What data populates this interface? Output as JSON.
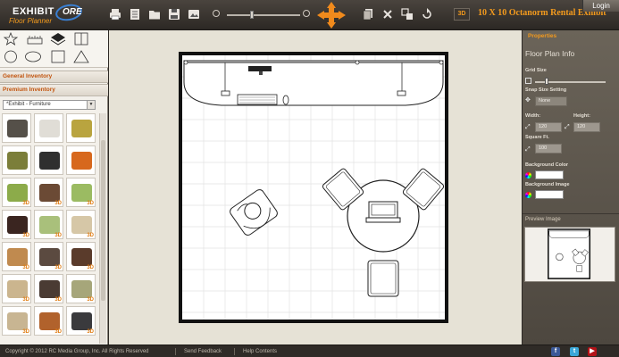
{
  "app": {
    "logo_word": "EXHIBIT",
    "logo_ore": "ORE",
    "logo_sub": "Floor Planner",
    "title": "10 X 10 Octanorm Rental Exhibit",
    "login_label": "Login",
    "view3d_label": "3D"
  },
  "toolbar": {
    "icons": [
      "print-icon",
      "document-icon",
      "folder-open-icon",
      "save-icon",
      "image-export-icon",
      "zoom-out-icon",
      "zoom-in-icon",
      "move-arrows-icon",
      "copy-icon",
      "delete-icon",
      "group-icon",
      "rotate-icon"
    ]
  },
  "left_panel": {
    "shape_tools": [
      "star-icon",
      "ruler-icon",
      "layers-icon",
      "floorplan-view-icon",
      "circle-icon",
      "ellipse-icon",
      "square-icon",
      "triangle-icon"
    ],
    "general_inventory_label": "General Inventory",
    "premium_inventory_label": "Premium Inventory",
    "category_value": "*Exhibit - Furniture",
    "badge_label": "3D",
    "thumbnails": [
      {
        "color": "#555049",
        "badge": false
      },
      {
        "color": "#e0ddd6",
        "badge": false
      },
      {
        "color": "#b9a43f",
        "badge": false
      },
      {
        "color": "#7b7e3a",
        "badge": false
      },
      {
        "color": "#2f2f2f",
        "badge": false
      },
      {
        "color": "#d7681d",
        "badge": false
      },
      {
        "color": "#8cab4a",
        "badge": true
      },
      {
        "color": "#6b4a35",
        "badge": true
      },
      {
        "color": "#9bbb62",
        "badge": true
      },
      {
        "color": "#3a2520",
        "badge": true
      },
      {
        "color": "#a9c07b",
        "badge": true
      },
      {
        "color": "#d6c7a7",
        "badge": true
      },
      {
        "color": "#c08a4f",
        "badge": true
      },
      {
        "color": "#5b4a40",
        "badge": true
      },
      {
        "color": "#5a3b2b",
        "badge": true
      },
      {
        "color": "#cbb58e",
        "badge": true
      },
      {
        "color": "#4a3b33",
        "badge": true
      },
      {
        "color": "#a6a67a",
        "badge": true
      },
      {
        "color": "#c8b592",
        "badge": true
      },
      {
        "color": "#b1622c",
        "badge": true
      },
      {
        "color": "#3a3a3d",
        "badge": true
      }
    ]
  },
  "properties": {
    "header": "Properties",
    "section_title": "Floor Plan Info",
    "grid_size_label": "Grid Size",
    "grid_size_level": 0.15,
    "snap_label": "Snap Size Setting",
    "snap_value": "None",
    "width_label": "Width:",
    "width_value": "120",
    "height_label": "Height:",
    "height_value": "120",
    "square_ft_label": "Square Ft.",
    "square_ft_value": "100",
    "bg_color_label": "Background Color",
    "bg_image_label": "Background Image",
    "preview_label": "Preview Image"
  },
  "footer": {
    "copyright": "Copyright © 2012 RC Media Group, Inc. All Rights Reserved",
    "send_feedback": "Send Feedback",
    "help_contents": "Help Contents",
    "social": [
      "facebook-icon",
      "twitter-icon",
      "youtube-icon"
    ]
  }
}
